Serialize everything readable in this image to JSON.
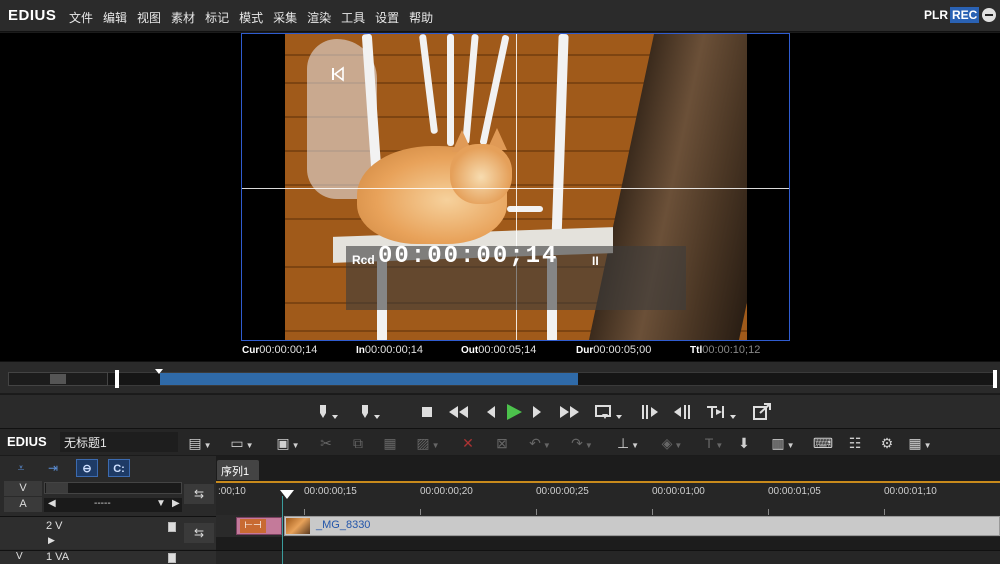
{
  "app": {
    "logo": "EDIUS",
    "plr": "PLR",
    "rec": "REC"
  },
  "menu": [
    "文件",
    "编辑",
    "视图",
    "素材",
    "标记",
    "模式",
    "采集",
    "渲染",
    "工具",
    "设置",
    "帮助"
  ],
  "player": {
    "rcd_label": "Rcd",
    "rcd_timecode": "00:00:00;14",
    "pause_symbol": "II"
  },
  "timecodes": [
    {
      "label": "Cur",
      "value": "00:00:00;14",
      "dim": false
    },
    {
      "label": "In",
      "value": "00:00:00;14",
      "dim": false
    },
    {
      "label": "Out",
      "value": "00:00:05;14",
      "dim": false
    },
    {
      "label": "Dur",
      "value": "00:00:05;00",
      "dim": false
    },
    {
      "label": "Ttl",
      "value": "00:00:10;12",
      "dim": true
    }
  ],
  "scrub": {
    "played_fraction": 0.42
  },
  "timeline": {
    "logo": "EDIUS",
    "project_name": "无标题1",
    "sequence_tab": "序列1",
    "ruler_ticks": [
      ":00;10",
      "00:00:00;15",
      "00:00:00;20",
      "00:00:00;25",
      "00:00:01;00",
      "00:00:01;05",
      "00:00:01;10"
    ],
    "row_v_label": "V",
    "row_a_label": "A",
    "row_a_value": "-----",
    "track_2v": "2 V",
    "track_1va": "1 VA",
    "track_1va_prefix": "V",
    "clip_name": "_MG_8330",
    "transition_symbol": "⊢⊣"
  },
  "colors": {
    "accent": "#2a62b4",
    "play": "#4cc24c",
    "clip": "#c9c9c9",
    "transition": "#c47a9a",
    "ruler_line": "#c88a1c"
  }
}
